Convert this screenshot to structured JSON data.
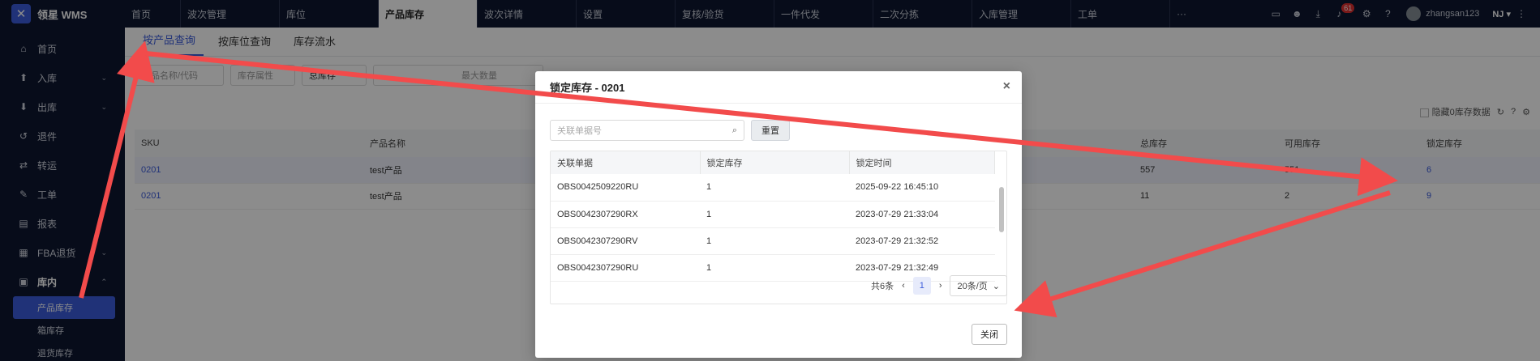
{
  "app": {
    "name": "领星 WMS",
    "logo_glyph": "✕"
  },
  "topnav": [
    {
      "label": "首页"
    },
    {
      "label": "波次管理"
    },
    {
      "label": "库位"
    },
    {
      "label": "产品库存",
      "active": true
    },
    {
      "label": "波次详情"
    },
    {
      "label": "设置"
    },
    {
      "label": "复核/验货"
    },
    {
      "label": "一件代发"
    },
    {
      "label": "二次分拣"
    },
    {
      "label": "入库管理"
    },
    {
      "label": "工单"
    },
    {
      "label": "···"
    }
  ],
  "topright": {
    "badge": "61",
    "username": "zhangsan123",
    "warehouse": "NJ ▾"
  },
  "sidebar": {
    "items": [
      {
        "label": "首页",
        "icon": "home-icon",
        "glyph": "⌂"
      },
      {
        "label": "入库",
        "icon": "inbound-icon",
        "glyph": "⬆",
        "chev": "⌄"
      },
      {
        "label": "出库",
        "icon": "outbound-icon",
        "glyph": "⬇",
        "chev": "⌄"
      },
      {
        "label": "退件",
        "icon": "return-icon",
        "glyph": "↺"
      },
      {
        "label": "转运",
        "icon": "transfer-icon",
        "glyph": "⇄"
      },
      {
        "label": "工单",
        "icon": "workorder-icon",
        "glyph": "✎"
      },
      {
        "label": "报表",
        "icon": "report-icon",
        "glyph": "▤"
      },
      {
        "label": "FBA退货",
        "icon": "fba-icon",
        "glyph": "▦",
        "chev": "⌄"
      },
      {
        "label": "库内",
        "icon": "warehouse-icon",
        "glyph": "▣",
        "chev": "⌃"
      }
    ],
    "sub": [
      {
        "label": "产品库存",
        "active": true
      },
      {
        "label": "箱库存"
      },
      {
        "label": "退货库存"
      }
    ]
  },
  "tabs": [
    {
      "label": "按产品查询",
      "active": true
    },
    {
      "label": "按库位查询"
    },
    {
      "label": "库存流水"
    }
  ],
  "filters": {
    "name_code": "产品名称/代码",
    "attr": "库存属性",
    "total": "总库存",
    "max_qty": "最大数量"
  },
  "toolbar": {
    "hide_zero": "隐藏0库存数据"
  },
  "table": {
    "headers": [
      "SKU",
      "产品名称",
      "",
      "总库存",
      "可用库存",
      "锁定库存"
    ],
    "rows": [
      [
        "0201",
        "test产品",
        "",
        "557",
        "551",
        "6"
      ],
      [
        "0201",
        "test产品",
        "",
        "11",
        "2",
        "9"
      ]
    ]
  },
  "dialog": {
    "title": "锁定库存 - 0201",
    "search_placeholder": "关联单据号",
    "reset_label": "重置",
    "headers": [
      "关联单据",
      "锁定库存",
      "锁定时间"
    ],
    "rows": [
      [
        "OBS0042509220RU",
        "1",
        "2025-09-22 16:45:10"
      ],
      [
        "OBS0042307290RX",
        "1",
        "2023-07-29 21:33:04"
      ],
      [
        "OBS0042307290RV",
        "1",
        "2023-07-29 21:32:52"
      ],
      [
        "OBS0042307290RU",
        "1",
        "2023-07-29 21:32:49"
      ]
    ],
    "total": "共6条",
    "page": "1",
    "page_size": "20条/页",
    "close_label": "关闭"
  }
}
